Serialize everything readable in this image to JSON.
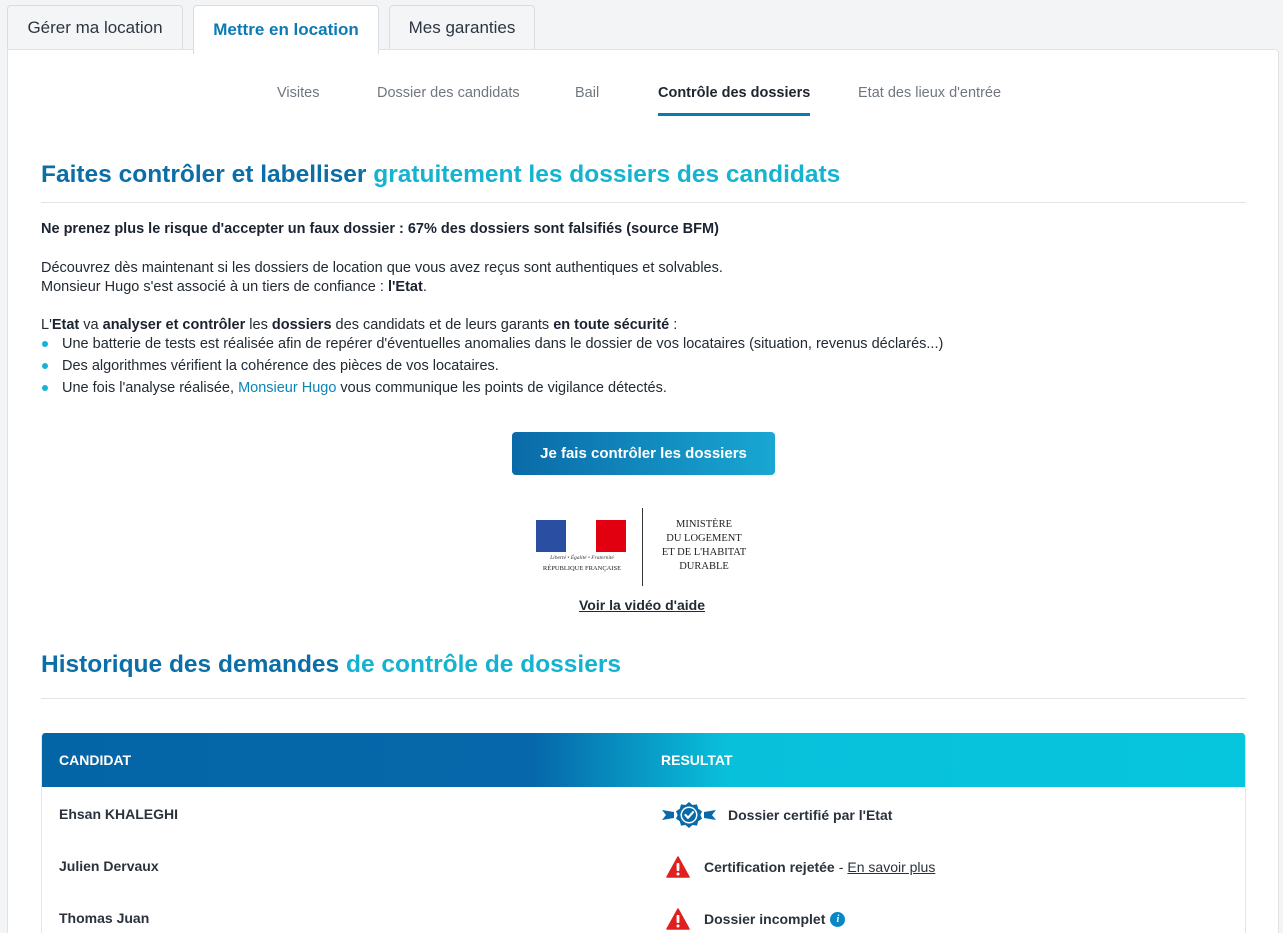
{
  "top_tabs": [
    "Gérer ma location",
    "Mettre en location",
    "Mes garanties"
  ],
  "subnav": [
    "Visites",
    "Dossier des candidats",
    "Bail",
    "Contrôle des dossiers",
    "Etat des lieux d'entrée"
  ],
  "section1": {
    "title_a": "Faites contrôler et labelliser",
    "title_b": "gratuitement les dossiers des candidats",
    "warning": "Ne prenez plus le risque d'accepter un faux dossier : 67% des dossiers sont falsifiés (source BFM)",
    "intro1": "Découvrez dès maintenant si les dossiers de location que vous avez reçus sont authentiques et solvables.",
    "intro2_pre": "Monsieur Hugo s'est associé à un tiers de confiance :",
    "intro2_bold": "l'Etat",
    "intro2_post": ".",
    "lead": {
      "l1": "L'",
      "b1": "Etat",
      "l2": " va ",
      "b2": "analyser et contrôler",
      "l3": " les ",
      "b3": "dossiers",
      "l4": " des candidats et de leurs garants ",
      "b4": "en toute sécurité",
      "l5": " :"
    },
    "bullets": [
      "Une batterie de tests est réalisée afin de repérer d'éventuelles anomalies dans le dossier de vos locataires (situation, revenus déclarés...)",
      "Des algorithmes vérifient la cohérence des pièces de vos locataires."
    ],
    "bullet3_pre": "Une fois l'analyse réalisée,",
    "bullet3_link": "Monsieur Hugo",
    "bullet3_post": "vous communique les points de vigilance détectés.",
    "cta": "Je fais contrôler les dossiers",
    "logo": {
      "motto": "Liberté • Égalité • Fraternité",
      "republic": "RÉPUBLIQUE FRANÇAISE",
      "ministry_lines": [
        "MINISTÈRE",
        "DU LOGEMENT",
        "ET DE L'HABITAT",
        "DURABLE"
      ]
    },
    "video_link": "Voir la vidéo d'aide"
  },
  "section2": {
    "title_a": "Historique des demandes",
    "title_b": "de contrôle de dossiers"
  },
  "table": {
    "headers": [
      "CANDIDAT",
      "RESULTAT"
    ],
    "rows": [
      {
        "name": "Ehsan KHALEGHI",
        "status": "Dossier certifié par l'Etat",
        "icon": "certified-badge-icon"
      },
      {
        "name": "Julien Dervaux",
        "status": "Certification rejetée",
        "sep": "-",
        "more": "En savoir plus",
        "icon": "warning-icon"
      },
      {
        "name": "Thomas Juan",
        "status": "Dossier incomplet",
        "icon": "warning-icon",
        "info": "i"
      }
    ]
  },
  "colors": {
    "brand_dark": "#0b6ea6",
    "brand_light": "#14b3d0",
    "warning_red": "#e02020",
    "flag_blue": "#2a4fa2",
    "flag_red": "#e1000f"
  }
}
